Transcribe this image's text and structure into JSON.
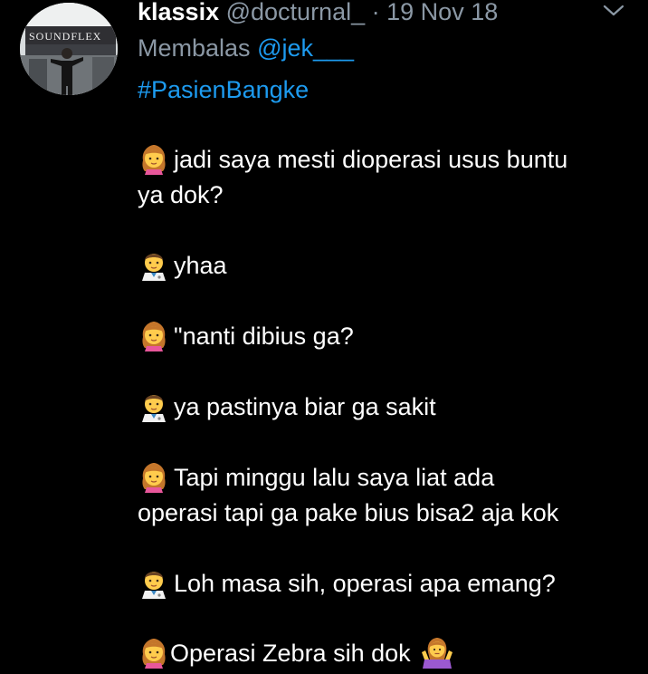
{
  "tweet": {
    "author_name": "klassix",
    "author_handle": "@docturnal_",
    "separator": "·",
    "date": "19 Nov 18",
    "avatar_text": "SOUNDFLEX",
    "reply_prefix": "Membalas",
    "reply_to": "@jek___",
    "hashtag": "#PasienBangke",
    "lines": [
      {
        "icon": "girl-emoji-icon",
        "text": "jadi saya mesti dioperasi usus buntu"
      },
      {
        "icon": "",
        "text": "ya dok?"
      },
      {
        "icon": "doctor-emoji-icon",
        "text": "yhaa"
      },
      {
        "icon": "girl-emoji-icon",
        "text": "\"nanti dibius ga?"
      },
      {
        "icon": "doctor-emoji-icon",
        "text": "ya pastinya biar ga sakit"
      },
      {
        "icon": "girl-emoji-icon",
        "text": "Tapi minggu lalu saya liat ada"
      },
      {
        "icon": "",
        "text": "operasi tapi ga pake bius bisa2 aja kok"
      },
      {
        "icon": "doctor-emoji-icon",
        "text": "Loh masa sih, operasi apa emang?"
      },
      {
        "icon": "girl-emoji-icon",
        "text": "Operasi Zebra sih dok",
        "trailing_icon": "shrug-emoji-icon"
      }
    ]
  },
  "colors": {
    "background": "#000000",
    "text": "#ffffff",
    "muted": "#8b98a5",
    "link": "#1d9bf0"
  }
}
